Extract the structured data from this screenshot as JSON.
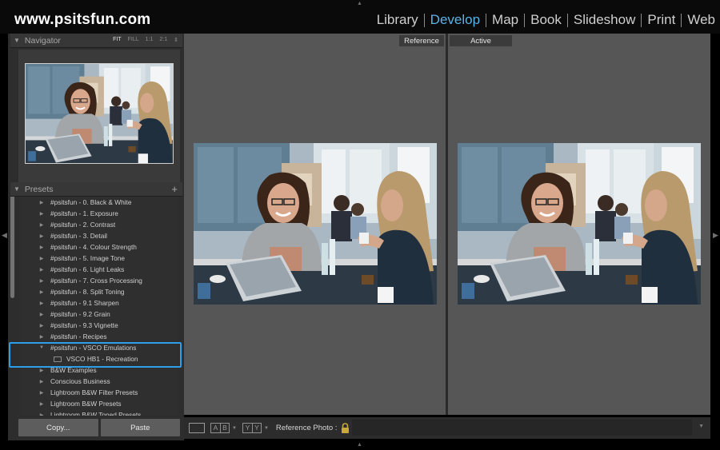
{
  "brand": "www.psitsfun.com",
  "modules": [
    "Library",
    "Develop",
    "Map",
    "Book",
    "Slideshow",
    "Print",
    "Web"
  ],
  "active_module": "Develop",
  "navigator": {
    "title": "Navigator",
    "zoom_options": [
      "FIT",
      "FILL",
      "1:1",
      "2:1"
    ],
    "zoom_selected": "FIT",
    "zoom_stepper_icon": "updown-icon"
  },
  "presets": {
    "title": "Presets",
    "add_icon": "+",
    "items": [
      {
        "label": "#psitsfun - 0. Black & White",
        "expanded": false
      },
      {
        "label": "#psitsfun - 1. Exposure",
        "expanded": false
      },
      {
        "label": "#psitsfun - 2. Contrast",
        "expanded": false
      },
      {
        "label": "#psitsfun - 3. Detail",
        "expanded": false
      },
      {
        "label": "#psitsfun - 4. Colour Strength",
        "expanded": false
      },
      {
        "label": "#psitsfun - 5. Image Tone",
        "expanded": false
      },
      {
        "label": "#psitsfun - 6. Light Leaks",
        "expanded": false
      },
      {
        "label": "#psitsfun - 7. Cross Processing",
        "expanded": false
      },
      {
        "label": "#psitsfun - 8. Split Toning",
        "expanded": false
      },
      {
        "label": "#psitsfun - 9.1 Sharpen",
        "expanded": false
      },
      {
        "label": "#psitsfun - 9.2 Grain",
        "expanded": false
      },
      {
        "label": "#psitsfun - 9.3 Vignette",
        "expanded": false
      },
      {
        "label": "#psitsfun - Recipes",
        "expanded": false
      },
      {
        "label": "#psitsfun - VSCO Emulations",
        "expanded": true
      },
      {
        "label": "VSCO HB1 - Recreation",
        "child": true
      },
      {
        "label": "B&W Examples",
        "expanded": false
      },
      {
        "label": "Conscious Business",
        "expanded": false
      },
      {
        "label": "Lightroom B&W Filter Presets",
        "expanded": false
      },
      {
        "label": "Lightroom B&W Presets",
        "expanded": false
      },
      {
        "label": "Lightroom B&W Toned Presets",
        "expanded": false
      }
    ]
  },
  "buttons": {
    "copy": "Copy...",
    "paste": "Paste"
  },
  "compare": {
    "reference_label": "Reference",
    "active_label": "Active"
  },
  "toolbar": {
    "ab_left": [
      "A",
      "B"
    ],
    "ab_right": [
      "Y",
      "Y"
    ],
    "reference_photo_label": "Reference Photo :"
  },
  "colors": {
    "accent": "#5ab3e8",
    "highlight": "#2f9ee8",
    "panel": "#2d2d2d",
    "canvas": "#565656"
  }
}
